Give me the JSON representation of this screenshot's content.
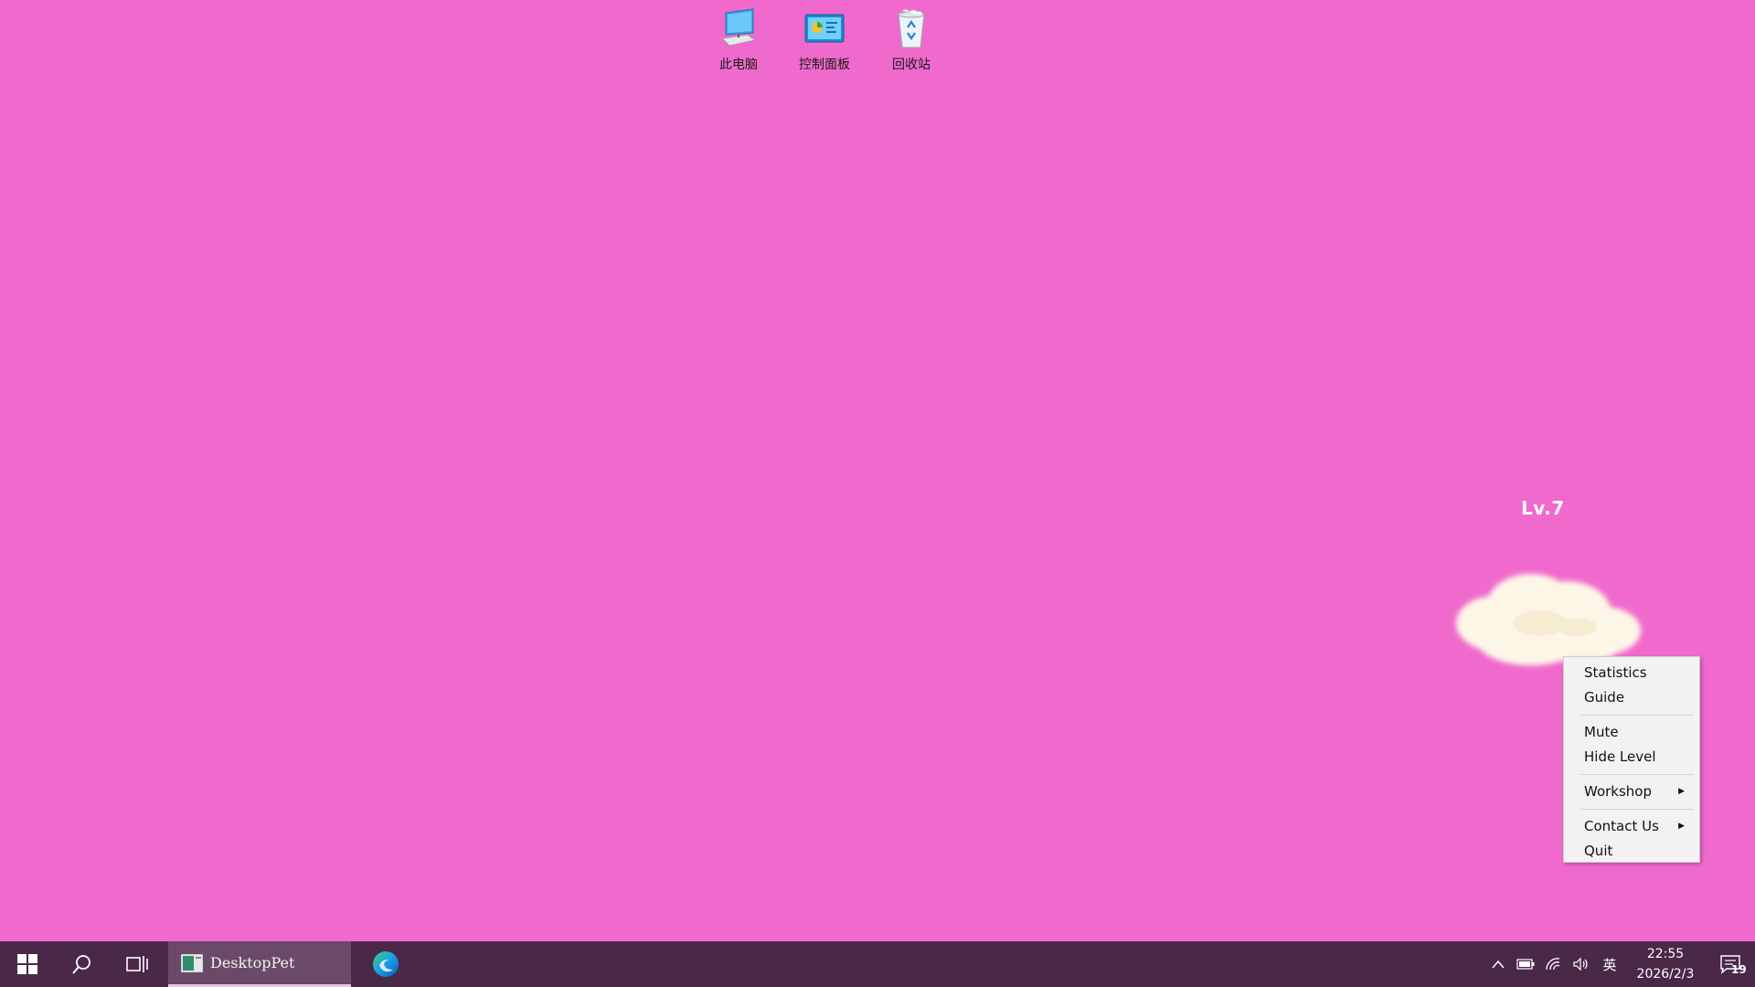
{
  "desktop": {
    "icons": [
      {
        "label": "此电脑",
        "icon": "computer-icon"
      },
      {
        "label": "控制面板",
        "icon": "control-panel-icon"
      },
      {
        "label": "回收站",
        "icon": "recycle-bin-icon"
      }
    ],
    "background_color": "#f06acd"
  },
  "pet": {
    "level_label": "Lv.7",
    "icon": "cloud-pet-icon"
  },
  "context_menu": {
    "items": [
      {
        "label": "Statistics"
      },
      {
        "label": "Guide"
      },
      {
        "label": "Mute"
      },
      {
        "label": "Hide Level"
      },
      {
        "label": "Workshop",
        "submenu": true
      },
      {
        "label": "Contact Us",
        "submenu": true
      },
      {
        "label": "Quit"
      }
    ]
  },
  "taskbar": {
    "start_icon": "windows-start-icon",
    "search_icon": "search-icon",
    "task_view_icon": "task-view-icon",
    "active_app": {
      "label": "DesktopPet",
      "icon": "desktop-pet-app-icon"
    },
    "pinned": [
      {
        "icon": "edge-browser-icon"
      }
    ],
    "tray": {
      "ime_label": "英",
      "time": "22:55",
      "date": "2026/2/3",
      "notification_count": "19"
    },
    "background_color": "#4a2848"
  }
}
